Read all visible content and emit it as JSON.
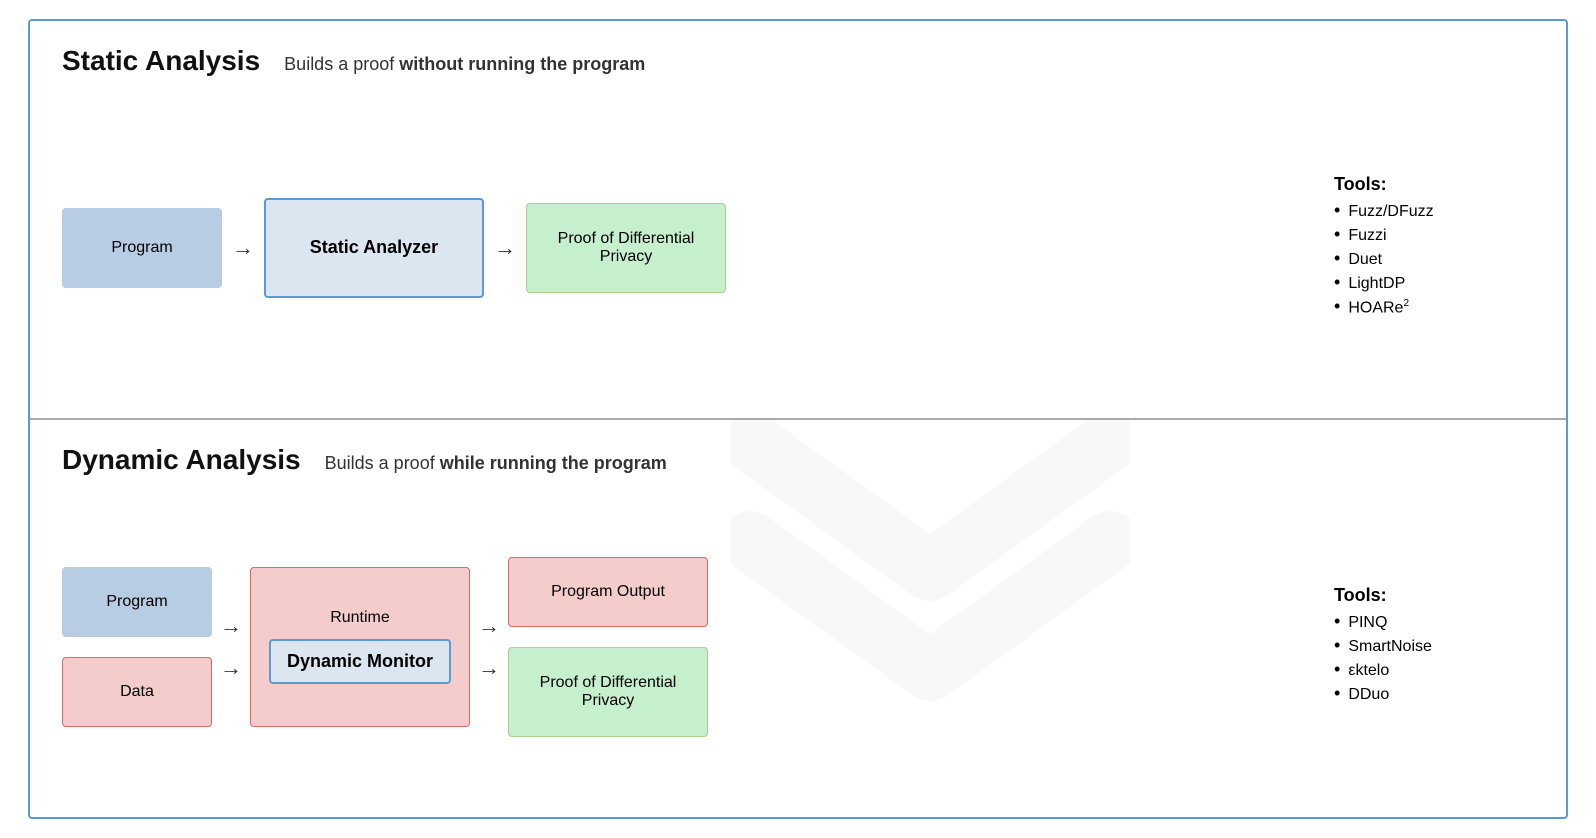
{
  "static": {
    "title": "Static Analysis",
    "desc_normal": "Builds a proof ",
    "desc_bold": "without running the program",
    "program_label": "Program",
    "analyzer_label": "Static Analyzer",
    "proof_label": "Proof of Differential Privacy",
    "tools_title": "Tools:",
    "tools": [
      "Fuzz/DFuzz",
      "Fuzzi",
      "Duet",
      "LightDP",
      "HOARe²"
    ]
  },
  "dynamic": {
    "title": "Dynamic Analysis",
    "desc_normal": "Builds a proof ",
    "desc_bold": "while running the program",
    "program_label": "Program",
    "data_label": "Data",
    "runtime_label": "Runtime",
    "monitor_label": "Dynamic Monitor",
    "program_output_label": "Program Output",
    "proof_label": "Proof of Differential Privacy",
    "tools_title": "Tools:",
    "tools": [
      "PINQ",
      "SmartNoise",
      "εktelo",
      "DDuo"
    ]
  }
}
